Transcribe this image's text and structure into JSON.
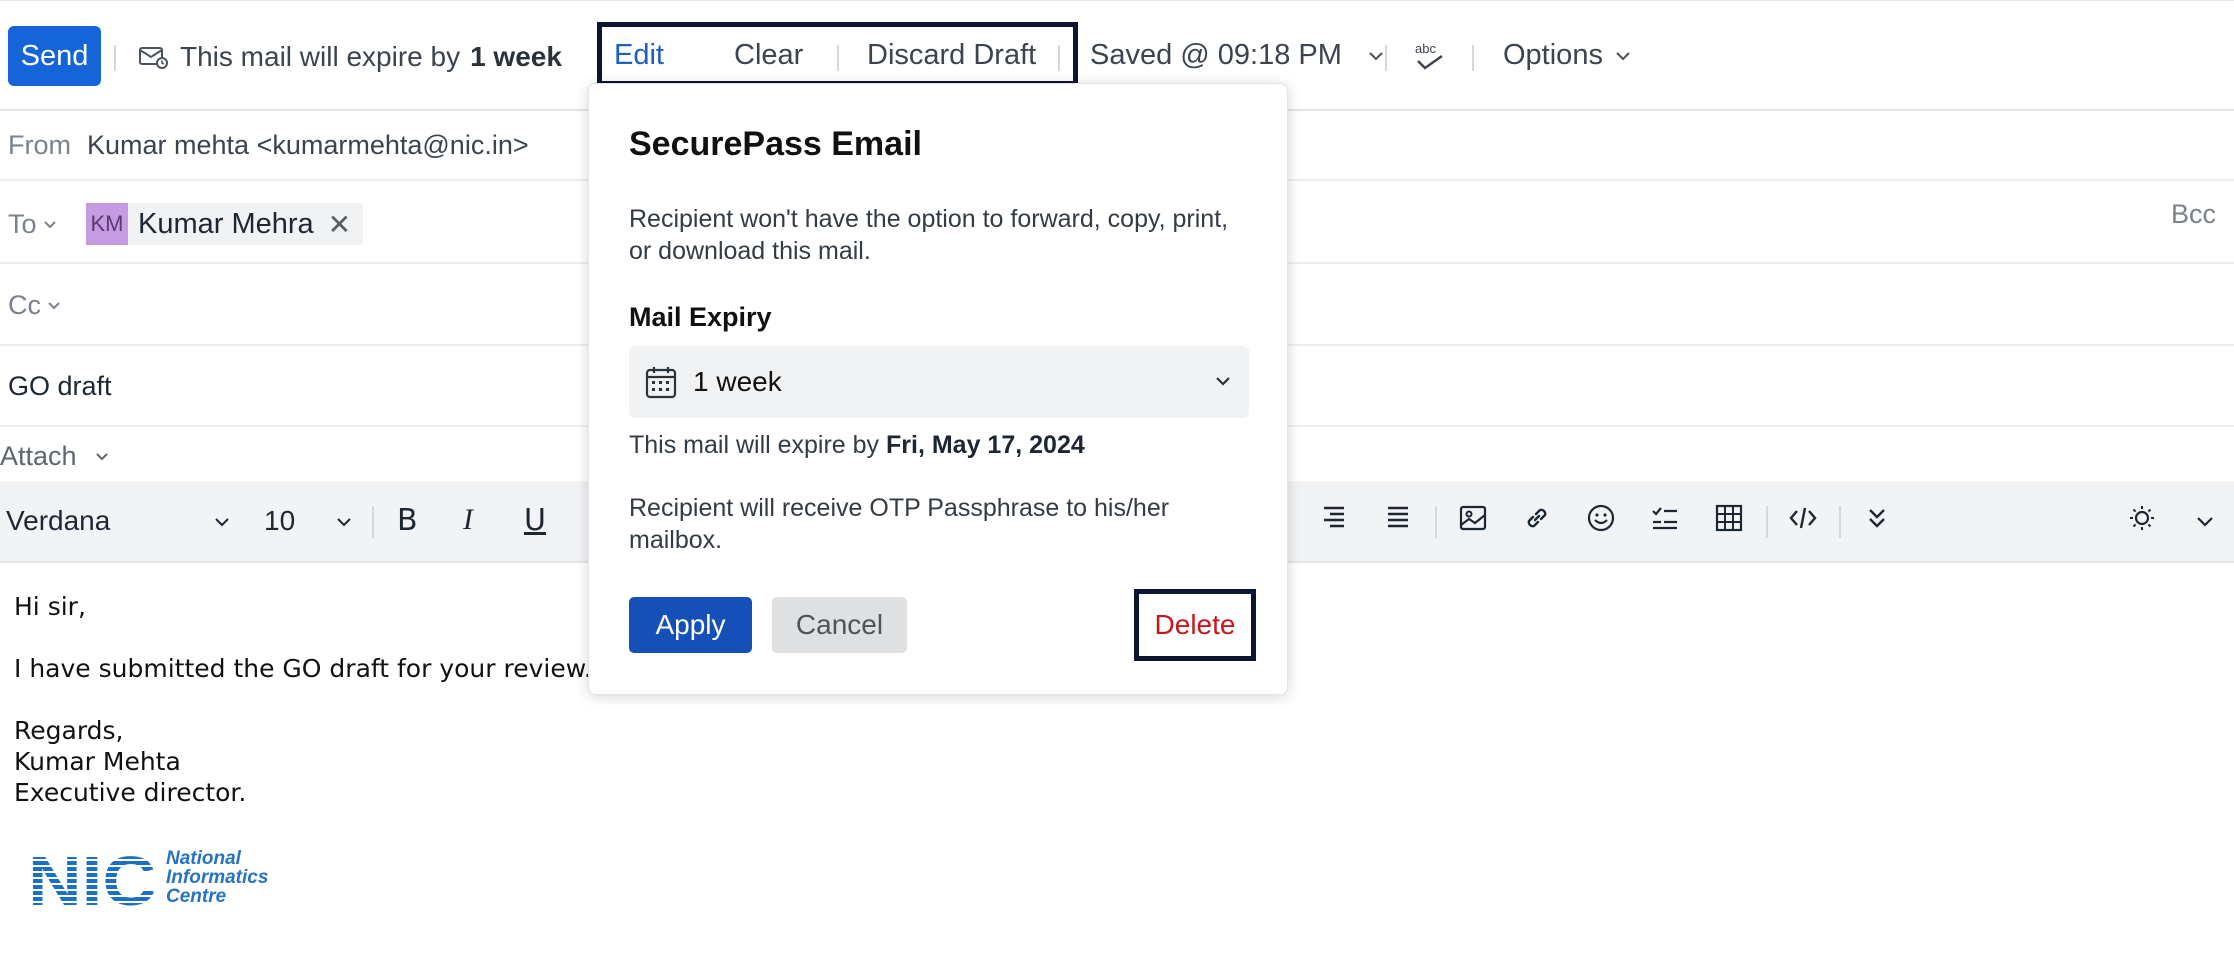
{
  "toolbar": {
    "send_label": "Send",
    "expire_prefix": "This mail will expire by",
    "expire_value": "1 week",
    "edit_label": "Edit",
    "clear_label": "Clear",
    "discard_label": "Discard Draft",
    "saved_label": "Saved @ 09:18 PM",
    "spell_icon": "spellcheck-icon",
    "options_label": "Options"
  },
  "header": {
    "from_label": "From",
    "from_value": "Kumar mehta <kumarmehta@nic.in>",
    "to_label": "To",
    "recipient_initials": "KM",
    "recipient_name": "Kumar Mehra",
    "bcc_label": "Bcc",
    "cc_label": "Cc",
    "subject": "GO draft",
    "attach_label": "Attach"
  },
  "format_bar": {
    "font": "Verdana",
    "size": "10",
    "bold": "B",
    "italic": "I",
    "underline": "U"
  },
  "body": {
    "greeting": "Hi sir,",
    "line1": "I have submitted the GO draft for your review.",
    "regards": "Regards,",
    "name": "Kumar Mehta",
    "title": "Executive director."
  },
  "logo": {
    "mark": "NIC",
    "line1": "National",
    "line2": "Informatics",
    "line3": "Centre",
    "color": "#1b6fc4"
  },
  "popup": {
    "title": "SecurePass Email",
    "description": "Recipient won't have the option to forward, copy, print, or download this mail.",
    "expiry_label": "Mail Expiry",
    "expiry_value": "1 week",
    "expire_prefix": "This mail will expire by",
    "expire_date": "Fri, May 17, 2024",
    "otp_note": "Recipient will receive OTP Passphrase to his/her mailbox.",
    "apply_label": "Apply",
    "cancel_label": "Cancel",
    "delete_label": "Delete"
  },
  "colors": {
    "accent": "#1565d8",
    "apply": "#1450b8",
    "delete": "#c8161a",
    "highlight_border": "#0c1533"
  }
}
